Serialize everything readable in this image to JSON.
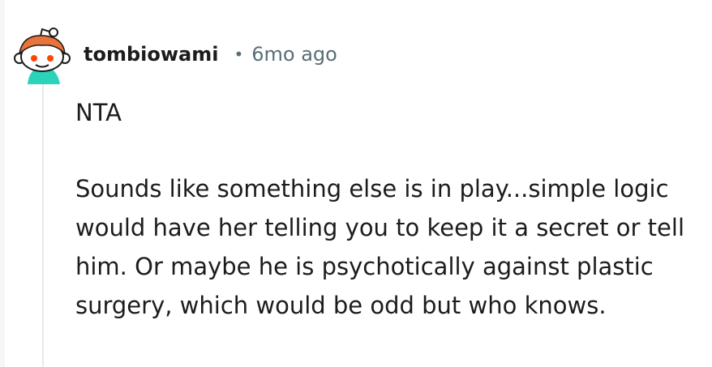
{
  "comment": {
    "author": "tombiowami",
    "separator": "•",
    "timestamp": "6mo ago",
    "avatar_icon": "reddit-snoo-avatar-icon",
    "paragraphs": [
      "NTA",
      "Sounds like something else is in play...simple logic would have her telling you to keep it a secret or tell him. Or maybe he is psychotically against plastic surgery, which would be odd but who knows."
    ]
  },
  "colors": {
    "text": "#1c1c1c",
    "meta": "#576f76",
    "thread_line": "#e5ebee",
    "avatar_hair": "#e8743b",
    "avatar_shirt": "#2bd3b8"
  }
}
